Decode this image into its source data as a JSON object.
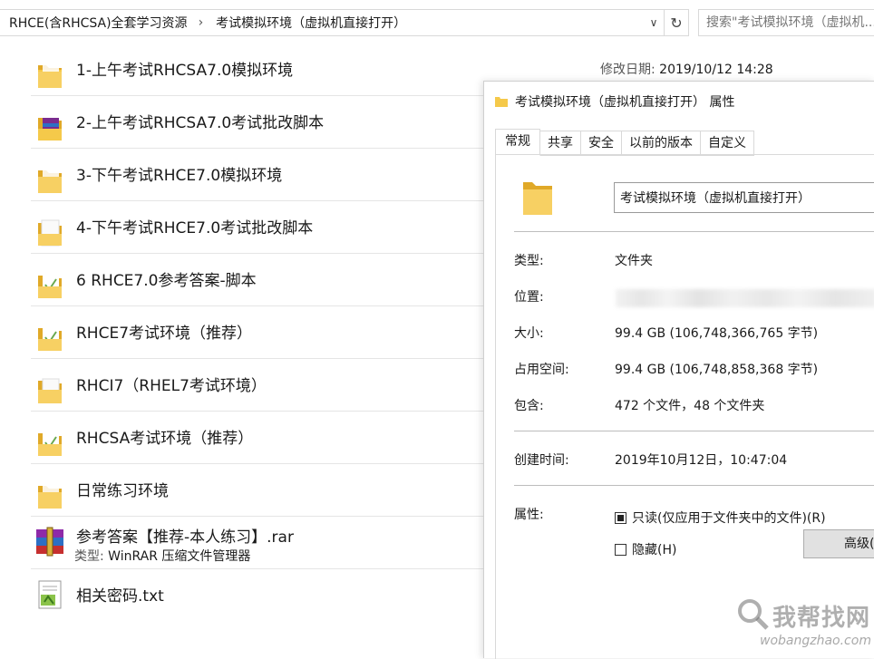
{
  "address": {
    "crumbs": [
      "RHCE(含RHCSA)全套学习资源",
      "考试模拟环境（虚拟机直接打开）"
    ],
    "dropdown_glyph": "∨",
    "refresh_glyph": "↻",
    "separator": "›"
  },
  "search": {
    "placeholder": "搜索\"考试模拟环境（虚拟机..."
  },
  "modified": {
    "label": "修改日期: ",
    "value": "2019/10/12 14:28"
  },
  "files": [
    {
      "name": "1-上午考试RHCSA7.0模拟环境",
      "icon": "folder-icon"
    },
    {
      "name": "2-上午考试RHCSA7.0考试批改脚本",
      "icon": "archive-folder-icon"
    },
    {
      "name": "3-下午考试RHCE7.0模拟环境",
      "icon": "folder-icon"
    },
    {
      "name": "4-下午考试RHCE7.0考试批改脚本",
      "icon": "folder-icon"
    },
    {
      "name": "6 RHCE7.0参考答案-脚本",
      "icon": "folder-icon"
    },
    {
      "name": "RHCE7考试环境（推荐）",
      "icon": "folder-icon"
    },
    {
      "name": "RHCI7（RHEL7考试环境）",
      "icon": "folder-icon"
    },
    {
      "name": "RHCSA考试环境（推荐）",
      "icon": "folder-icon"
    },
    {
      "name": "日常练习环境",
      "icon": "folder-icon"
    },
    {
      "name": "参考答案【推荐-本人练习】.rar",
      "icon": "winrar-icon",
      "type_label": "类型: ",
      "type_value": "WinRAR 压缩文件管理器"
    },
    {
      "name": "相关密码.txt",
      "icon": "text-file-icon"
    }
  ],
  "dialog": {
    "title": "考试模拟环境（虚拟机直接打开） 属性",
    "tabs": [
      "常规",
      "共享",
      "安全",
      "以前的版本",
      "自定义"
    ],
    "folder_name": "考试模拟环境（虚拟机直接打开）",
    "type_label": "类型:",
    "type_value": "文件夹",
    "location_label": "位置:",
    "size_label": "大小:",
    "size_value": "99.4 GB (106,748,366,765 字节)",
    "disk_label": "占用空间:",
    "disk_value": "99.4 GB (106,748,858,368 字节)",
    "contains_label": "包含:",
    "contains_value": "472 个文件，48 个文件夹",
    "created_label": "创建时间:",
    "created_value": "2019年10月12日，10:47:04",
    "attr_label": "属性:",
    "readonly_label": "只读(仅应用于文件夹中的文件)(R)",
    "hidden_label": "隐藏(H)",
    "advanced_label": "高级(D)..."
  },
  "watermark": {
    "text": "我帮找网",
    "url": "wobangzhao.com"
  },
  "colors": {
    "folder": "#f5c94a",
    "folder_dark": "#e0a928",
    "accent": "#0078d7"
  }
}
